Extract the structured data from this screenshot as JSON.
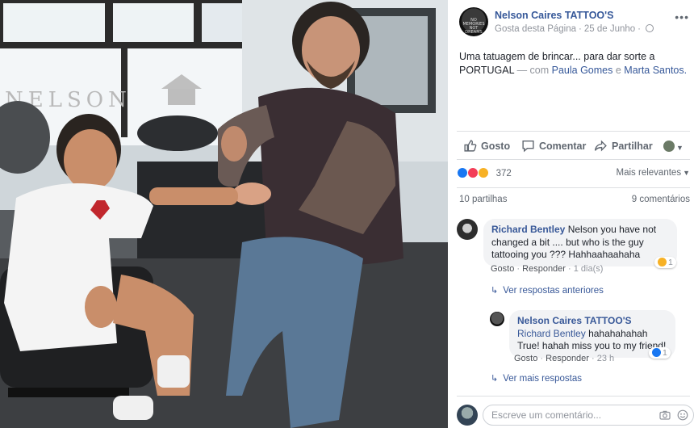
{
  "post": {
    "page_name": "Nelson Caires TATTOO'S",
    "avatar_text": "NO MEMORIES NOT DREAMS",
    "gosta_label": "Gosta desta Página",
    "date": "25 de Junho",
    "text": "Uma tatuagem de brincar... para dar sorte a PORTUGAL",
    "with_prefix": "— com",
    "tag1": "Paula Gomes",
    "and_word": "e",
    "tag2": "Marta Santos."
  },
  "photo": {
    "sign_text": "NELSON"
  },
  "actions": {
    "like": "Gosto",
    "comment": "Comentar",
    "share": "Partilhar"
  },
  "reactions": {
    "count": "372",
    "sort_label": "Mais relevantes",
    "types": [
      "like",
      "love",
      "haha"
    ]
  },
  "stats": {
    "shares": "10 partilhas",
    "comments": "9 comentários"
  },
  "comments": [
    {
      "author": "Richard Bentley",
      "text": "Nelson you have not changed a bit .... but who is the guy tattooing you ??? Hahhaahaahaha",
      "like": "Gosto",
      "reply": "Responder",
      "time": "1 dia(s)",
      "reaction": "haha",
      "reaction_count": "1",
      "view_previous": "Ver respostas anteriores"
    },
    {
      "author": "Nelson Caires TATTOO'S",
      "mention": "Richard Bentley",
      "text": "hahahahahah True! hahah miss you to my friend!",
      "like": "Gosto",
      "reply": "Responder",
      "time": "23 h",
      "reaction": "like",
      "reaction_count": "1",
      "view_more": "Ver mais respostas"
    }
  ],
  "composer": {
    "placeholder": "Escreve um comentário..."
  },
  "colors": {
    "link": "#365899",
    "muted": "#90949c",
    "like_blue": "#1877f2",
    "love_red": "#f33e58",
    "haha_yellow": "#f7b125"
  }
}
